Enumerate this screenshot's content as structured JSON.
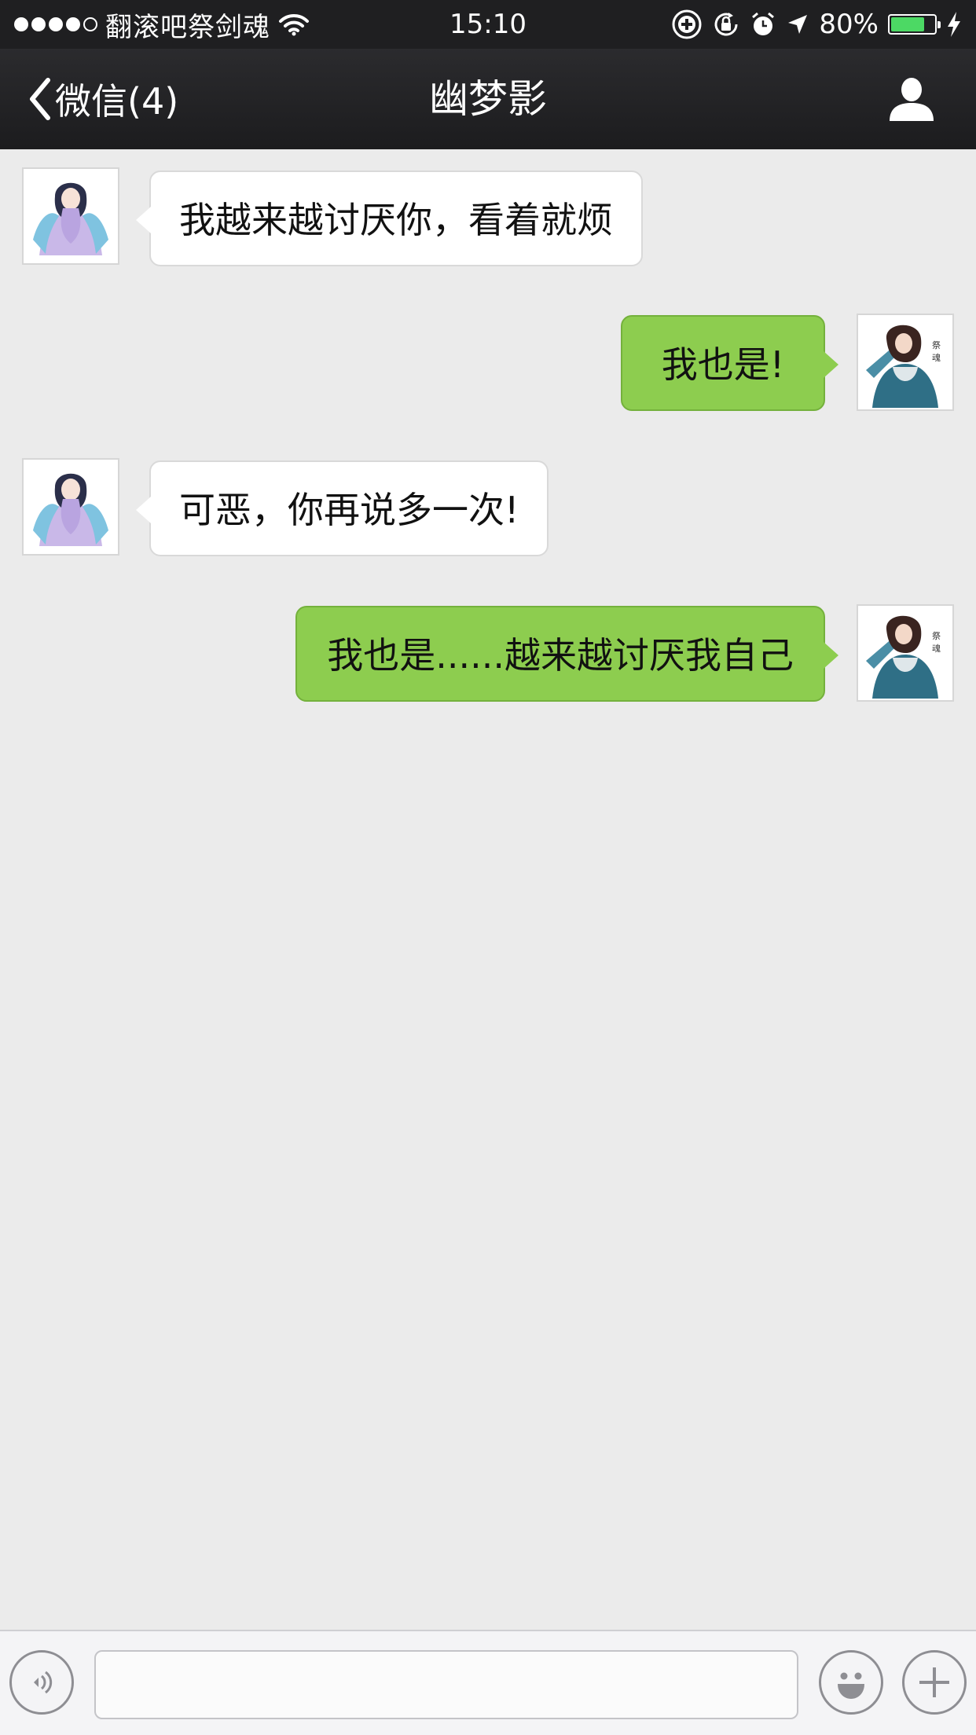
{
  "status_bar": {
    "carrier": "翻滚吧祭剑魂",
    "time": "15:10",
    "battery_percent": "80%",
    "battery_level": 0.8,
    "signal_bars": 4,
    "signal_total": 5
  },
  "nav": {
    "back_label": "微信(4)",
    "title": "幽梦影"
  },
  "messages": [
    {
      "direction": "incoming",
      "text": "我越来越讨厌你，看着就烦"
    },
    {
      "direction": "outgoing",
      "text": "我也是!"
    },
    {
      "direction": "incoming",
      "text": "可恶，你再说多一次!"
    },
    {
      "direction": "outgoing",
      "text": "我也是......越来越讨厌我自己"
    }
  ],
  "input": {
    "value": "",
    "placeholder": ""
  },
  "colors": {
    "outgoing_bubble": "#8dcd4f",
    "incoming_bubble": "#ffffff",
    "background": "#ebebeb",
    "header": "#1f1f21",
    "battery": "#4cd964"
  }
}
